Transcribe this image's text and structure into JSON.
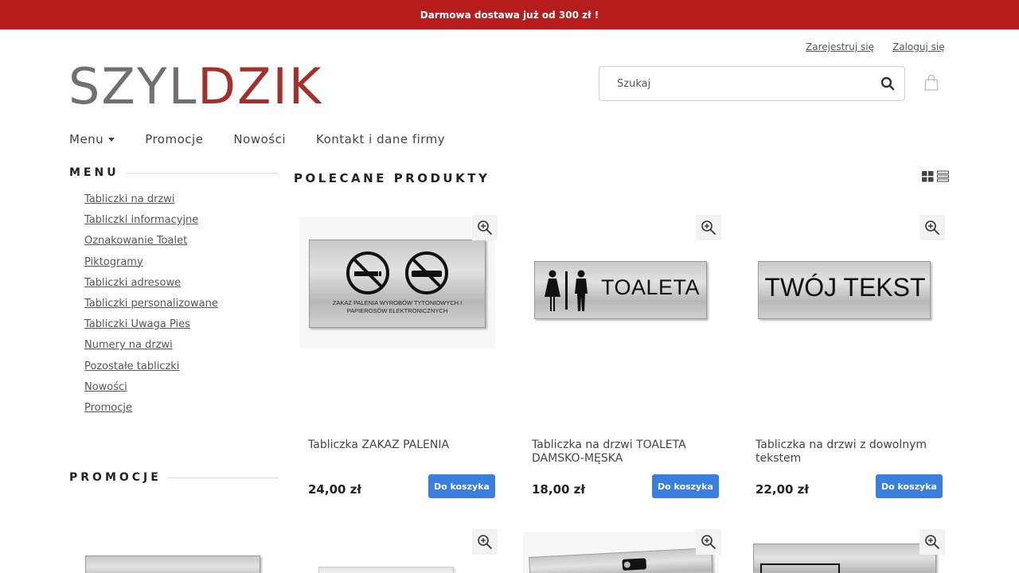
{
  "topbar": {
    "text": "Darmowa dostawa już od 300 zł !"
  },
  "account": {
    "register": "Zarejestruj się",
    "login": "Zaloguj się"
  },
  "logo": {
    "part1": "SZYL",
    "part2": "DZIK"
  },
  "search": {
    "placeholder": "Szukaj"
  },
  "nav": {
    "items": [
      "Menu",
      "Promocje",
      "Nowości",
      "Kontakt i dane firmy"
    ]
  },
  "sidebar": {
    "menu_title": "MENU",
    "items": [
      "Tabliczki na drzwi",
      "Tabliczki informacyjne",
      "Oznakowanie Toalet",
      "Piktogramy",
      "Tabliczki adresowe",
      "Tabliczki personalizowane",
      "Tabliczki Uwaga Pies",
      "Numery na drzwi",
      "Pozostałe tabliczki",
      "Nowości",
      "Promocje"
    ],
    "promo_title": "PROMOCJE"
  },
  "main": {
    "title": "POLECANE PRODUKTY",
    "products": [
      {
        "name": "Tabliczka ZAKAZ PALENIA",
        "price": "24,00 zł",
        "button": "Do koszyka",
        "plate_text": "ZAKAZ PALENIA WYROBÓW TYTONIOWYCH I PAPIEROSÓW ELEKTRONICZNYCH"
      },
      {
        "name": "Tabliczka na drzwi TOALETA DAMSKO-MĘSKA",
        "price": "18,00 zł",
        "button": "Do koszyka",
        "plate_text": "TOALETA"
      },
      {
        "name": "Tabliczka na drzwi z dowolnym tekstem",
        "price": "22,00 zł",
        "button": "Do koszyka",
        "plate_text": "TWÓJ TEKST"
      }
    ]
  },
  "colors": {
    "topbar": "#b71c1c",
    "logo_gray": "#707070",
    "logo_red": "#a3302a",
    "button": "#3a7fde"
  }
}
